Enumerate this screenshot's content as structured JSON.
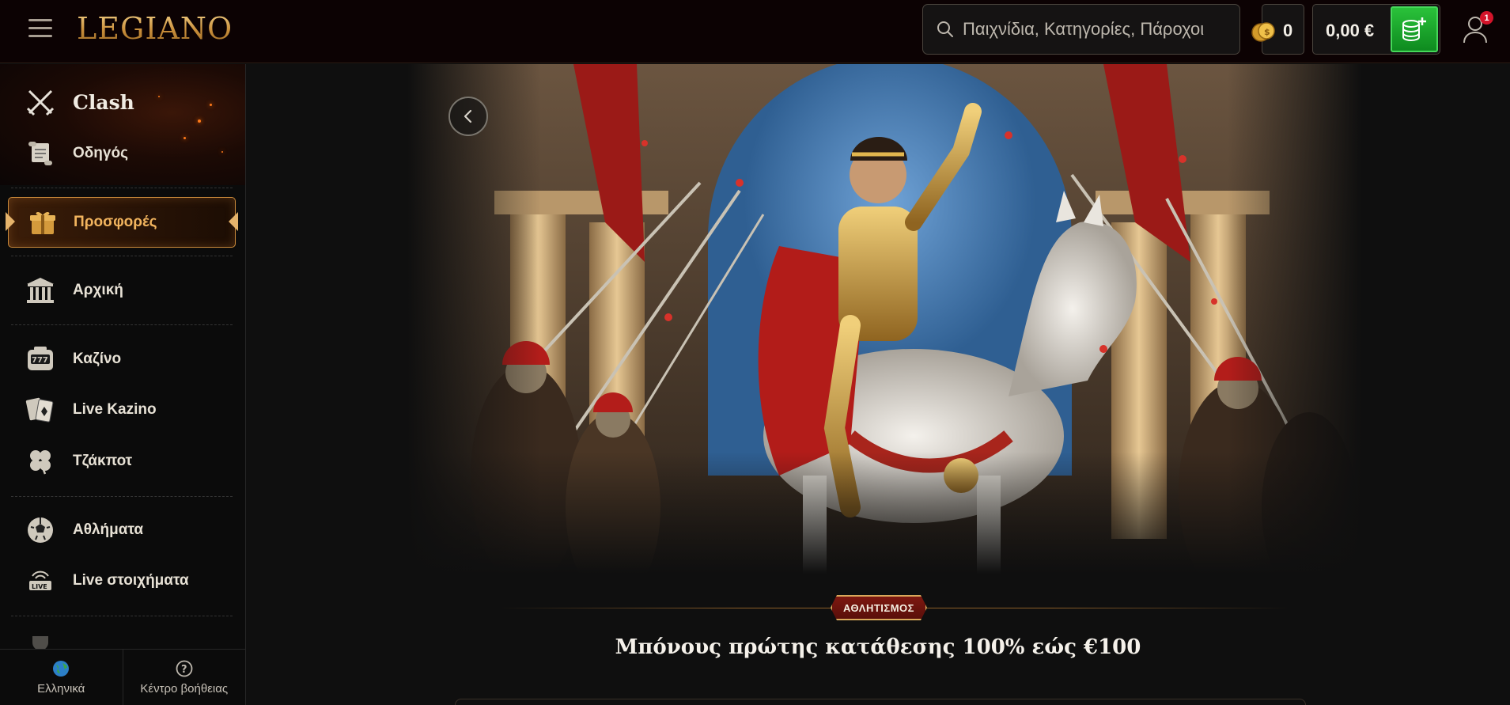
{
  "header": {
    "logo_text": "LEGIANO",
    "search_placeholder": "Παιχνίδια, Κατηγορίες, Πάροχοι",
    "coins_count": "0",
    "balance": "0,00 €",
    "notification_count": "1"
  },
  "sidebar": {
    "clash_label": "Clash",
    "items": [
      {
        "label": "Οδηγός",
        "icon": "scroll-icon"
      },
      {
        "label": "Προσφορές",
        "icon": "gift-icon",
        "active": true
      },
      {
        "label": "Αρχική",
        "icon": "temple-icon"
      },
      {
        "label": "Καζίνο",
        "icon": "slot-machine-icon"
      },
      {
        "label": "Live Kazino",
        "icon": "playing-cards-icon"
      },
      {
        "label": "Τζάκποτ",
        "icon": "clover-icon"
      },
      {
        "label": "Αθλήματα",
        "icon": "soccer-ball-icon"
      },
      {
        "label": "Live στοιχήματα",
        "icon": "live-broadcast-icon"
      }
    ],
    "footer": {
      "language_label": "Ελληνικά",
      "help_label": "Κέντρο βοήθειας"
    }
  },
  "banner": {
    "category": "ΑΘΛΗΤΙΣΜΟΣ",
    "title": "Μπόνους πρώτης κατάθεσης 100% εώς €100"
  },
  "colors": {
    "accent_gold": "#d9a85b",
    "deposit_green": "#1aa82c",
    "badge_red": "#7d1810",
    "notification_red": "#d4142a"
  }
}
